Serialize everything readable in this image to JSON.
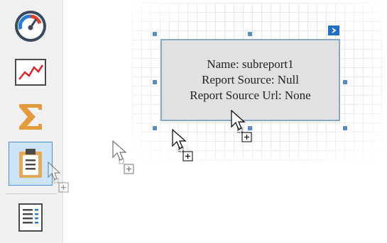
{
  "toolbox": {
    "items": [
      {
        "name": "gauge",
        "icon": "gauge-icon"
      },
      {
        "name": "sparkline",
        "icon": "sparkline-icon"
      },
      {
        "name": "cross-tab",
        "icon": "sum-icon"
      },
      {
        "name": "subreport",
        "icon": "subreport-icon",
        "selected": true
      },
      {
        "name": "table-of-contents",
        "icon": "table-of-contents-icon"
      }
    ]
  },
  "control": {
    "line1": "Name: subreport1",
    "line2": "Report Source: Null",
    "line3": "Report Source Url: None"
  },
  "colors": {
    "selection_handle": "#5b8bc1",
    "smart_tag": "#1f6fc4",
    "control_fill": "#e1e1e1",
    "selected_tool_fill": "#cde4f7"
  }
}
